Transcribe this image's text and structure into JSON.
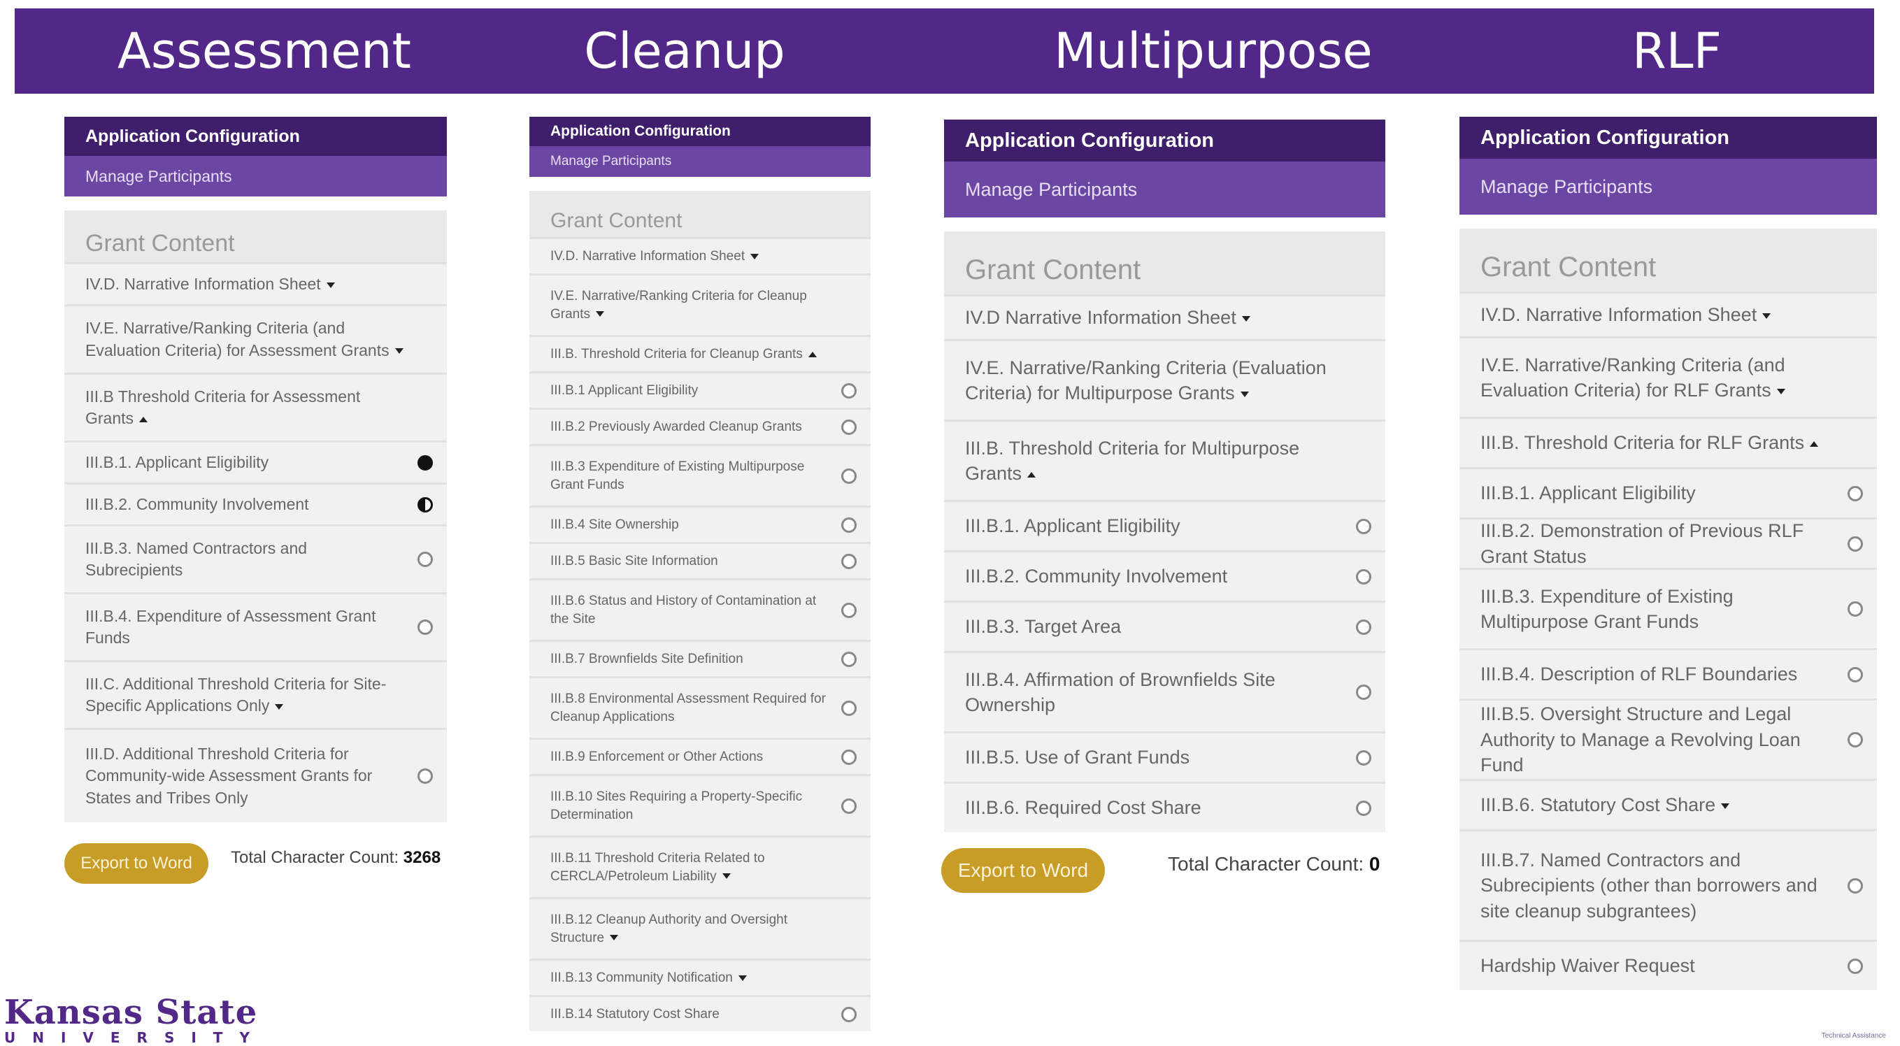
{
  "banner": {
    "titles": [
      "Assessment",
      "Cleanup",
      "Multipurpose",
      "RLF"
    ]
  },
  "panels": [
    {
      "config_title": "Application Configuration",
      "manage_label": "Manage Participants",
      "grant_title": "Grant Content",
      "items": [
        {
          "label": "IV.D. Narrative Information Sheet",
          "caret": "down",
          "status": "none"
        },
        {
          "label": "IV.E. Narrative/Ranking Criteria (and Evaluation Criteria) for Assessment Grants",
          "caret": "down",
          "status": "none"
        },
        {
          "label": "III.B Threshold Criteria for Assessment Grants",
          "caret": "up",
          "status": "none"
        },
        {
          "label": "III.B.1. Applicant Eligibility",
          "caret": "",
          "status": "full"
        },
        {
          "label": "III.B.2. Community Involvement",
          "caret": "",
          "status": "half"
        },
        {
          "label": "III.B.3. Named Contractors and Subrecipients",
          "caret": "",
          "status": "empty"
        },
        {
          "label": "III.B.4. Expenditure of Assessment Grant Funds",
          "caret": "",
          "status": "empty"
        },
        {
          "label": "III.C. Additional Threshold Criteria for Site-Specific Applications Only",
          "caret": "down",
          "status": "none"
        },
        {
          "label": "III.D. Additional Threshold Criteria for Community-wide Assessment Grants for States and Tribes Only",
          "caret": "",
          "status": "empty"
        }
      ],
      "export_label": "Export to Word",
      "count_label": "Total Character Count:",
      "count_value": "3268"
    },
    {
      "config_title": "Application Configuration",
      "manage_label": "Manage Participants",
      "grant_title": "Grant Content",
      "items": [
        {
          "label": "IV.D. Narrative Information Sheet",
          "caret": "down",
          "status": "none"
        },
        {
          "label": "IV.E. Narrative/Ranking Criteria for Cleanup Grants",
          "caret": "down",
          "status": "none"
        },
        {
          "label": "III.B. Threshold Criteria for Cleanup Grants",
          "caret": "up",
          "status": "none"
        },
        {
          "label": "III.B.1 Applicant Eligibility",
          "caret": "",
          "status": "empty"
        },
        {
          "label": "III.B.2 Previously Awarded Cleanup Grants",
          "caret": "",
          "status": "empty"
        },
        {
          "label": "III.B.3 Expenditure of Existing Multipurpose Grant Funds",
          "caret": "",
          "status": "empty"
        },
        {
          "label": "III.B.4 Site Ownership",
          "caret": "",
          "status": "empty"
        },
        {
          "label": "III.B.5 Basic Site Information",
          "caret": "",
          "status": "empty"
        },
        {
          "label": "III.B.6 Status and History of Contamination at the Site",
          "caret": "",
          "status": "empty"
        },
        {
          "label": "III.B.7 Brownfields Site Definition",
          "caret": "",
          "status": "empty"
        },
        {
          "label": "III.B.8 Environmental Assessment Required for Cleanup Applications",
          "caret": "",
          "status": "empty"
        },
        {
          "label": "III.B.9 Enforcement or Other Actions",
          "caret": "",
          "status": "empty"
        },
        {
          "label": "III.B.10 Sites Requiring a Property-Specific Determination",
          "caret": "",
          "status": "empty"
        },
        {
          "label": "III.B.11 Threshold Criteria Related to CERCLA/Petroleum Liability",
          "caret": "down",
          "status": "none"
        },
        {
          "label": "III.B.12 Cleanup Authority and Oversight Structure",
          "caret": "down",
          "status": "none"
        },
        {
          "label": "III.B.13 Community Notification",
          "caret": "down",
          "status": "none"
        },
        {
          "label": "III.B.14 Statutory Cost Share",
          "caret": "",
          "status": "empty"
        }
      ]
    },
    {
      "config_title": "Application Configuration",
      "manage_label": "Manage Participants",
      "grant_title": "Grant Content",
      "items": [
        {
          "label": "IV.D Narrative Information Sheet",
          "caret": "down",
          "status": "none"
        },
        {
          "label": "IV.E. Narrative/Ranking Criteria (Evaluation Criteria) for Multipurpose Grants",
          "caret": "down",
          "status": "none"
        },
        {
          "label": "III.B. Threshold Criteria for Multipurpose Grants",
          "caret": "up",
          "status": "none"
        },
        {
          "label": "III.B.1. Applicant Eligibility",
          "caret": "",
          "status": "empty"
        },
        {
          "label": "III.B.2. Community Involvement",
          "caret": "",
          "status": "empty"
        },
        {
          "label": "III.B.3. Target Area",
          "caret": "",
          "status": "empty"
        },
        {
          "label": "III.B.4. Affirmation of Brownfields Site Ownership",
          "caret": "",
          "status": "empty"
        },
        {
          "label": "III.B.5. Use of Grant Funds",
          "caret": "",
          "status": "empty"
        },
        {
          "label": "III.B.6. Required Cost Share",
          "caret": "",
          "status": "empty"
        }
      ],
      "export_label": "Export to Word",
      "count_label": "Total Character Count:",
      "count_value": "0"
    },
    {
      "config_title": "Application Configuration",
      "manage_label": "Manage Participants",
      "grant_title": "Grant Content",
      "items": [
        {
          "label": "IV.D. Narrative Information Sheet",
          "caret": "down",
          "status": "none"
        },
        {
          "label": "IV.E. Narrative/Ranking Criteria (and Evaluation Criteria) for RLF Grants",
          "caret": "down",
          "status": "none"
        },
        {
          "label": "III.B. Threshold Criteria for RLF Grants",
          "caret": "up",
          "status": "none"
        },
        {
          "label": "III.B.1. Applicant Eligibility",
          "caret": "",
          "status": "empty"
        },
        {
          "label": "III.B.2. Demonstration of Previous RLF Grant Status",
          "caret": "",
          "status": "empty"
        },
        {
          "label": "III.B.3. Expenditure of Existing Multipurpose Grant Funds",
          "caret": "",
          "status": "empty"
        },
        {
          "label": "III.B.4. Description of RLF Boundaries",
          "caret": "",
          "status": "empty"
        },
        {
          "label": "III.B.5. Oversight Structure and Legal Authority to Manage a Revolving Loan Fund",
          "caret": "",
          "status": "empty"
        },
        {
          "label": "III.B.6. Statutory Cost Share",
          "caret": "down",
          "status": "none"
        },
        {
          "label": "III.B.7. Named Contractors and Subrecipients (other than borrowers and site cleanup subgrantees)",
          "caret": "",
          "status": "empty"
        },
        {
          "label": "Hardship Waiver Request",
          "caret": "",
          "status": "empty"
        }
      ]
    }
  ],
  "logo": {
    "line1": "Kansas State",
    "line2": "UNIVERSITY"
  },
  "footer_note": "Technical Assistance"
}
